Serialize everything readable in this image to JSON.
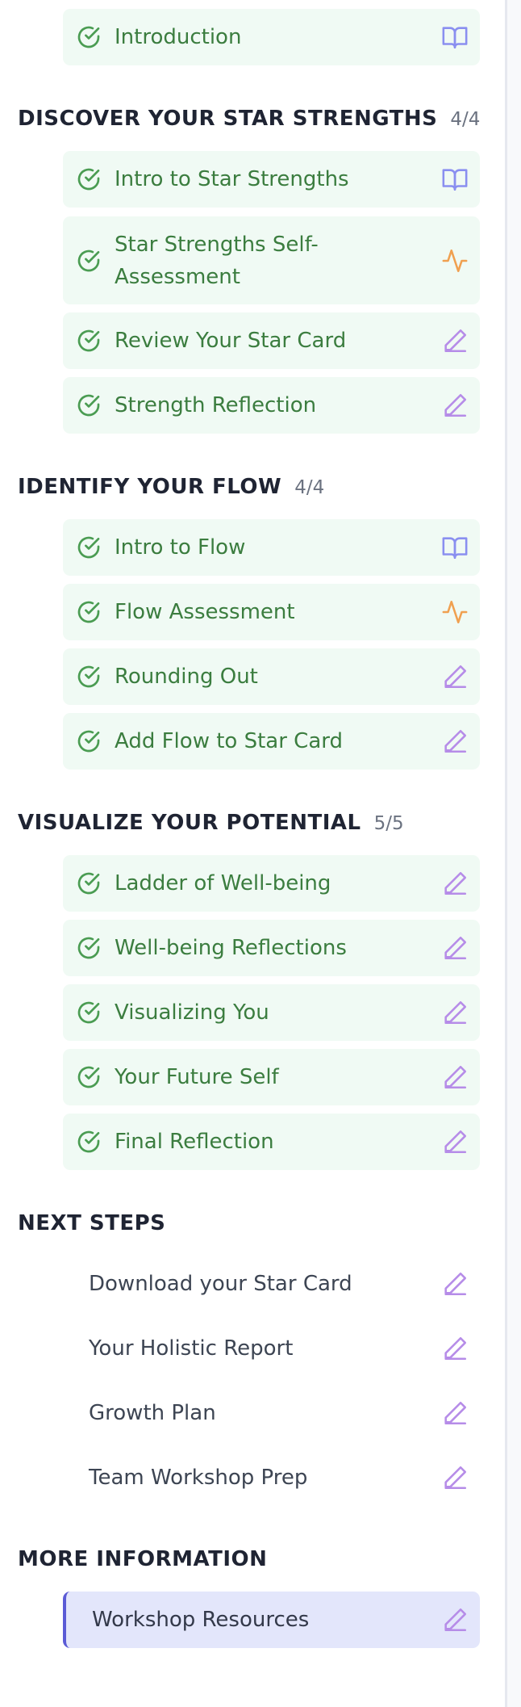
{
  "colors": {
    "complete_bg": "#f0faf4",
    "complete_text": "#3b7d3f",
    "check": "#4a9c52",
    "book_icon": "#8a8ff0",
    "assessment_icon": "#f0a050",
    "pencil_icon": "#b68ce8",
    "active_bg": "#e3e6fb",
    "active_border": "#5b5bd6"
  },
  "intro": {
    "label": "Introduction",
    "icon": "book-icon"
  },
  "sections": [
    {
      "title": "DISCOVER YOUR STAR STRENGTHS",
      "count": "4/4",
      "items": [
        {
          "label": "Intro to Star Strengths",
          "icon": "book-icon"
        },
        {
          "label": "Star Strengths Self-Assessment",
          "icon": "activity-icon"
        },
        {
          "label": "Review Your Star Card",
          "icon": "pencil-icon"
        },
        {
          "label": "Strength Reflection",
          "icon": "pencil-icon"
        }
      ]
    },
    {
      "title": "IDENTIFY YOUR FLOW",
      "count": "4/4",
      "items": [
        {
          "label": "Intro to Flow",
          "icon": "book-icon"
        },
        {
          "label": "Flow Assessment",
          "icon": "activity-icon"
        },
        {
          "label": "Rounding Out",
          "icon": "pencil-icon"
        },
        {
          "label": "Add Flow to Star Card",
          "icon": "pencil-icon"
        }
      ]
    },
    {
      "title": "VISUALIZE YOUR POTENTIAL",
      "count": "5/5",
      "items": [
        {
          "label": "Ladder of Well-being",
          "icon": "pencil-icon"
        },
        {
          "label": "Well-being Reflections",
          "icon": "pencil-icon"
        },
        {
          "label": "Visualizing You",
          "icon": "pencil-icon"
        },
        {
          "label": "Your Future Self",
          "icon": "pencil-icon"
        },
        {
          "label": "Final Reflection",
          "icon": "pencil-icon"
        }
      ]
    },
    {
      "title": "NEXT STEPS",
      "count": "",
      "items": [
        {
          "label": "Download your Star Card",
          "icon": "pencil-icon"
        },
        {
          "label": "Your Holistic Report",
          "icon": "pencil-icon"
        },
        {
          "label": "Growth Plan",
          "icon": "pencil-icon"
        },
        {
          "label": "Team Workshop Prep",
          "icon": "pencil-icon"
        }
      ]
    },
    {
      "title": "MORE INFORMATION",
      "count": "",
      "items": [
        {
          "label": "Workshop Resources",
          "icon": "pencil-icon"
        }
      ]
    }
  ]
}
